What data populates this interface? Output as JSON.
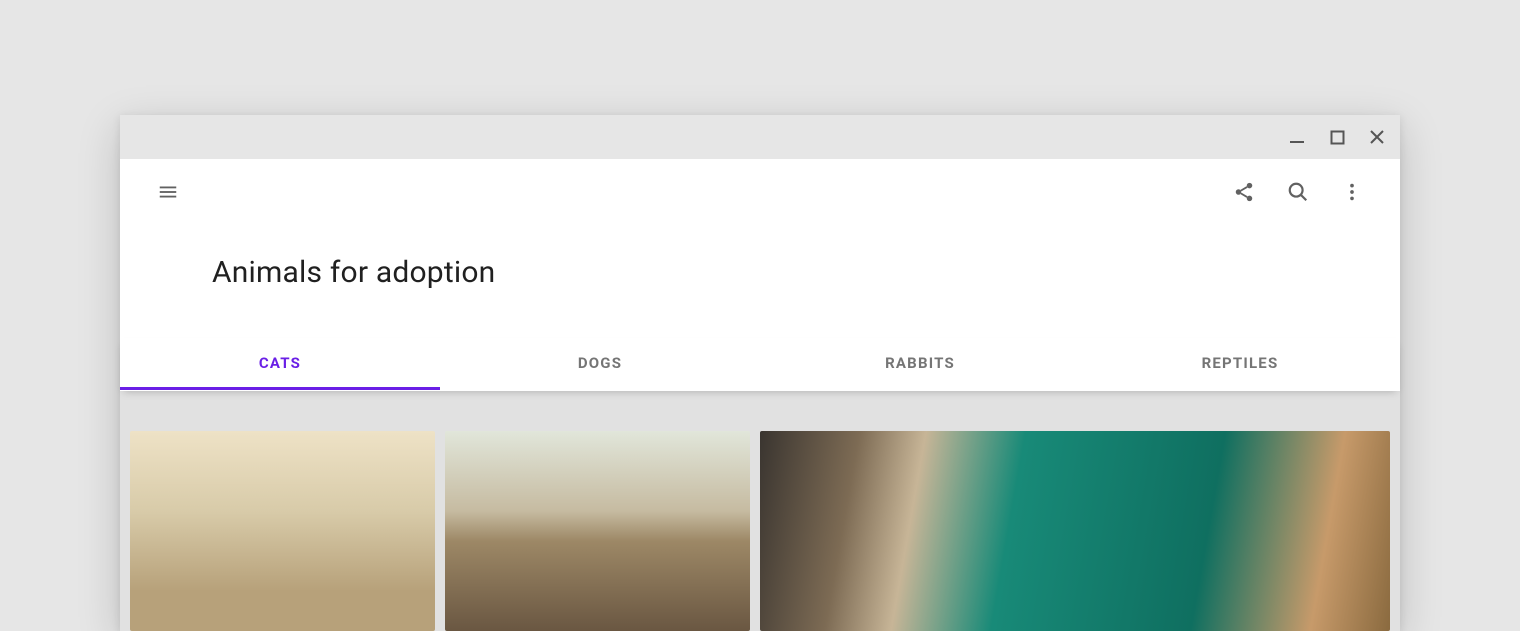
{
  "header": {
    "title": "Animals for adoption"
  },
  "tabs": [
    {
      "label": "CATS",
      "active": true
    },
    {
      "label": "DOGS",
      "active": false
    },
    {
      "label": "RABBITS",
      "active": false
    },
    {
      "label": "REPTILES",
      "active": false
    }
  ],
  "colors": {
    "accent": "#6a1fe6"
  }
}
